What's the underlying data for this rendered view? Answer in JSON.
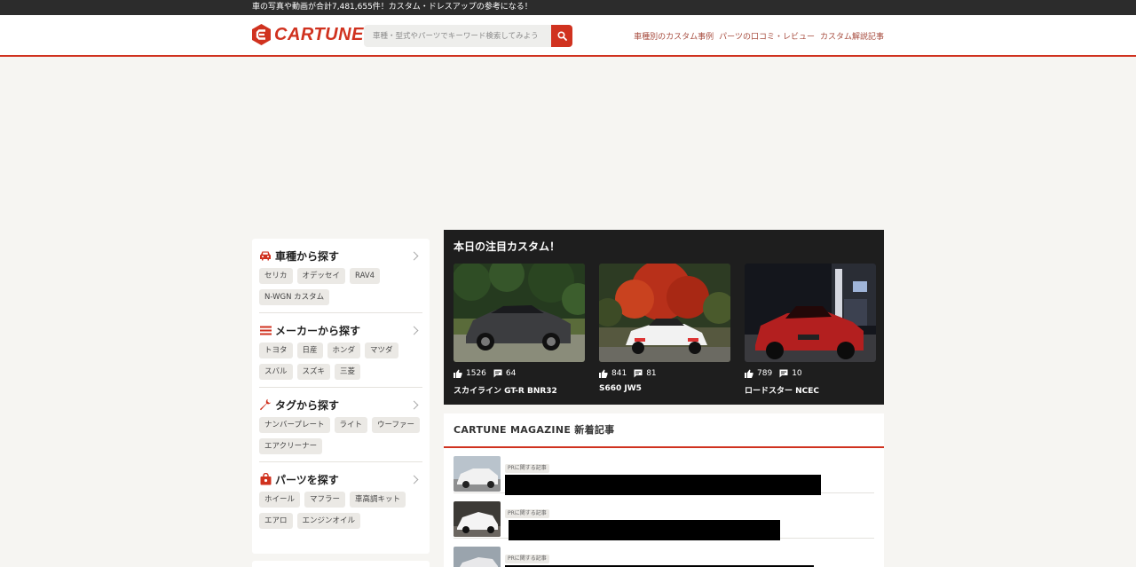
{
  "topbar": {
    "text": "車の写真や動画が合計7,481,655件！カスタム・ドレスアップの参考になる！"
  },
  "header": {
    "logo_text": "CARTUNE",
    "search_placeholder": "車種・型式やパーツでキーワード検索してみよう",
    "nav": [
      "車種別のカスタム事例",
      "パーツの口コミ・レビュー",
      "カスタム解説記事"
    ]
  },
  "sidebar": {
    "sections": [
      {
        "title": "車種から探す",
        "icon": "car-icon",
        "chips": [
          "セリカ",
          "オデッセイ",
          "RAV4",
          "N-WGN カスタム"
        ]
      },
      {
        "title": "メーカーから探す",
        "icon": "menu-lines-icon",
        "chips": [
          "トヨタ",
          "日産",
          "ホンダ",
          "マツダ",
          "スバル",
          "スズキ",
          "三菱"
        ]
      },
      {
        "title": "タグから探す",
        "icon": "wrench-icon",
        "chips": [
          "ナンバープレート",
          "ライト",
          "ウーファー",
          "エアクリーナー"
        ]
      },
      {
        "title": "パーツを探す",
        "icon": "shopping-bag-icon",
        "chips": [
          "ホイール",
          "マフラー",
          "車高調キット",
          "エアロ",
          "エンジンオイル"
        ]
      }
    ]
  },
  "featured": {
    "title": "本日の注目カスタム！",
    "cards": [
      {
        "likes": "1526",
        "comments": "64",
        "name": "スカイライン GT-R BNR32"
      },
      {
        "likes": "841",
        "comments": "81",
        "name": "S660 JW5"
      },
      {
        "likes": "789",
        "comments": "10",
        "name": "ロードスター NCEC"
      }
    ]
  },
  "magazine": {
    "title": "CARTUNE MAGAZINE 新着記事",
    "items": [
      {
        "badge": "PRに関する記事"
      },
      {
        "badge": "PRに関する記事"
      },
      {
        "badge": "PRに関する記事"
      }
    ]
  },
  "colors": {
    "brand": "#d0321f",
    "dark_panel": "#1e1e1e",
    "page_bg": "#f6f5f2"
  }
}
